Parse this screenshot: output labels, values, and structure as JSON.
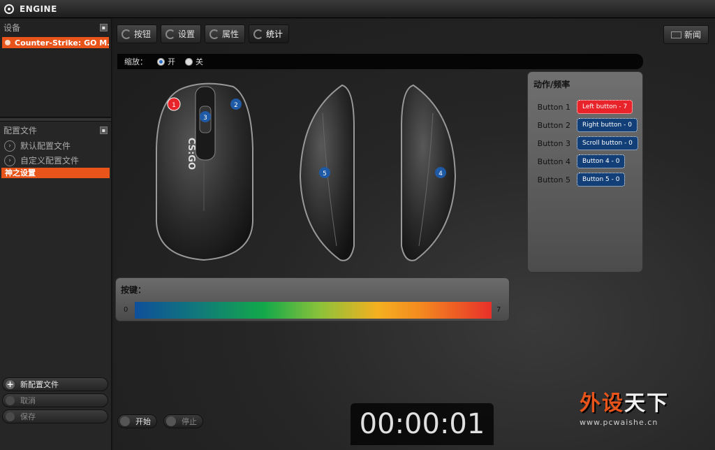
{
  "app": {
    "title": "ENGINE"
  },
  "sidebar": {
    "devices_header": "设备",
    "device": "Counter-Strike: GO M...",
    "profiles_header": "配置文件",
    "profiles": [
      {
        "label": "默认配置文件"
      },
      {
        "label": "自定义配置文件"
      }
    ],
    "active_profile": "神之设置",
    "buttons": {
      "new_profile": "新配置文件",
      "cancel": "取消",
      "save": "保存"
    }
  },
  "toolbar": {
    "tabs": [
      {
        "label": "按钮"
      },
      {
        "label": "设置"
      },
      {
        "label": "属性"
      },
      {
        "label": "统计"
      }
    ],
    "news": "新闻"
  },
  "zoom": {
    "label": "缩放：",
    "on": "开",
    "off": "关",
    "selected": "开"
  },
  "mouse": {
    "logo": "CS:GO",
    "badges": [
      "1",
      "2",
      "3",
      "4",
      "5"
    ]
  },
  "frequency": {
    "title": "动作/频率",
    "rows": [
      {
        "label": "Button 1",
        "action": "Left button - 7",
        "color": "#e8232a"
      },
      {
        "label": "Button 2",
        "action": "Right button - 0",
        "color": "#123f78"
      },
      {
        "label": "Button 3",
        "action": "Scroll button - 0",
        "color": "#123f78"
      },
      {
        "label": "Button 4",
        "action": "Button 4 - 0",
        "color": "#123f78"
      },
      {
        "label": "Button 5",
        "action": "Button 5 - 0",
        "color": "#123f78"
      }
    ]
  },
  "keypress": {
    "title": "按键：",
    "min": "0",
    "max": "7"
  },
  "controls": {
    "start": "开始",
    "stop": "停止"
  },
  "timer": "00:00:01",
  "watermark": {
    "part1": "外设",
    "part2": "天下",
    "url": "www.pcwaishe.cn"
  }
}
